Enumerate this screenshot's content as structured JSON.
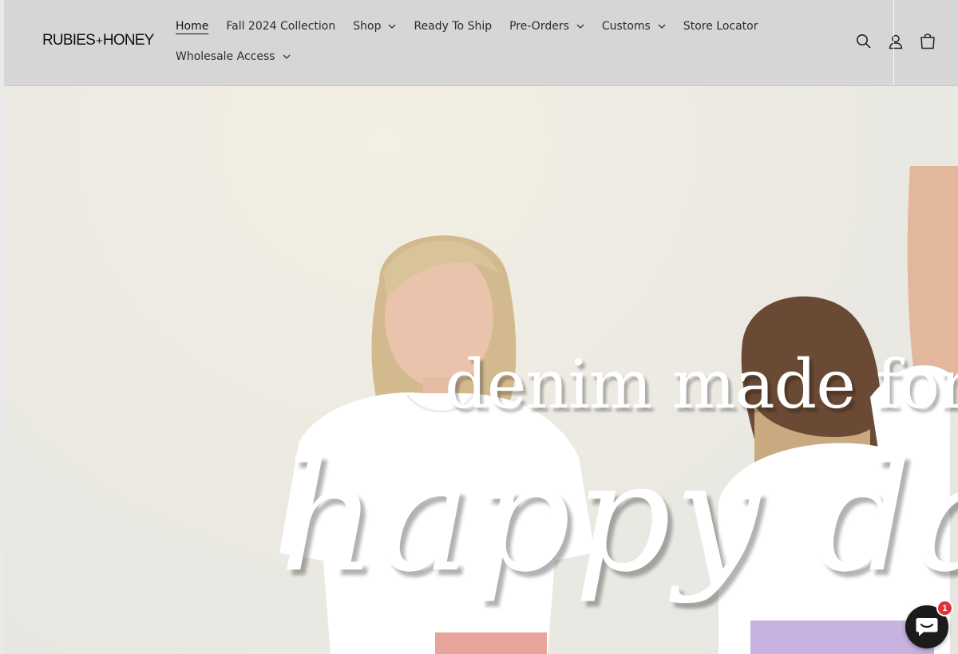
{
  "brand": {
    "logo_left": "RUBIES",
    "logo_plus": "+",
    "logo_right": "HONEY"
  },
  "nav": {
    "row1": [
      {
        "label": "Home",
        "active": true,
        "has_dropdown": false
      },
      {
        "label": "Fall 2024 Collection",
        "has_dropdown": false
      },
      {
        "label": "Shop",
        "has_dropdown": true
      },
      {
        "label": "Ready To Ship",
        "has_dropdown": false
      },
      {
        "label": "Pre-Orders",
        "has_dropdown": true
      },
      {
        "label": "Customs",
        "has_dropdown": true
      },
      {
        "label": "Store Locator",
        "has_dropdown": false
      }
    ],
    "row2": [
      {
        "label": "Wholesale Access",
        "has_dropdown": true
      }
    ]
  },
  "header_icons": [
    "search-icon",
    "account-icon",
    "cart-icon"
  ],
  "hero": {
    "headline_line1": "denim made for",
    "headline_line2": "happy danc"
  },
  "chat": {
    "icon": "chat-icon",
    "badge_count": "1"
  },
  "colors": {
    "header_bg": "#d6d6d6",
    "badge": "#e0323a",
    "chat_bg": "#1b1b1b"
  }
}
